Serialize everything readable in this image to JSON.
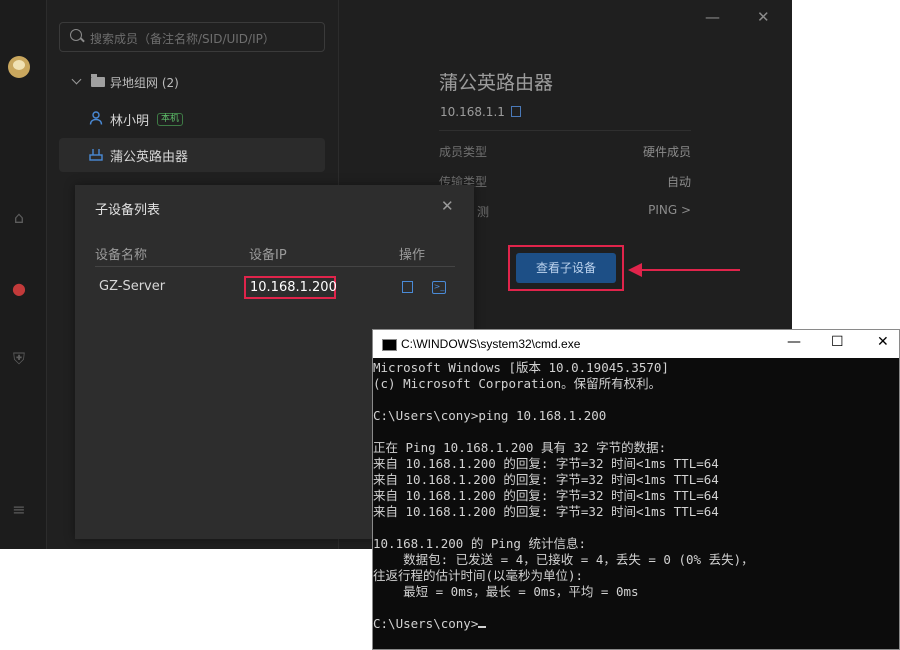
{
  "sidebar": {
    "search_placeholder": "搜索成员（备注名称/SID/UID/IP）",
    "group": {
      "label": "异地组网 (2)"
    },
    "members": [
      {
        "name": "林小明",
        "tag": "本机"
      },
      {
        "name": "蒲公英路由器"
      }
    ]
  },
  "detail": {
    "title": "蒲公英路由器",
    "ip": "10.168.1.1",
    "rows": [
      {
        "key": "成员类型",
        "value": "硬件成员"
      },
      {
        "key": "传输类型",
        "value": "自动"
      },
      {
        "key": "测",
        "value": "PING >"
      }
    ],
    "view_button": "查看子设备"
  },
  "window_controls": {
    "minimize": "—",
    "close": "✕"
  },
  "modal": {
    "title": "子设备列表",
    "close": "✕",
    "columns": [
      "设备名称",
      "设备IP",
      "操作"
    ],
    "row": {
      "name": "GZ-Server",
      "ip": "10.168.1.200"
    }
  },
  "cmd": {
    "title": "C:\\WINDOWS\\system32\\cmd.exe",
    "min": "—",
    "max": "☐",
    "close": "✕",
    "lines": [
      "Microsoft Windows [版本 10.0.19045.3570]",
      "(c) Microsoft Corporation。保留所有权利。",
      "",
      "C:\\Users\\cony>ping 10.168.1.200",
      "",
      "正在 Ping 10.168.1.200 具有 32 字节的数据:",
      "来自 10.168.1.200 的回复: 字节=32 时间<1ms TTL=64",
      "来自 10.168.1.200 的回复: 字节=32 时间<1ms TTL=64",
      "来自 10.168.1.200 的回复: 字节=32 时间<1ms TTL=64",
      "来自 10.168.1.200 的回复: 字节=32 时间<1ms TTL=64",
      "",
      "10.168.1.200 的 Ping 统计信息:",
      "    数据包: 已发送 = 4，已接收 = 4，丢失 = 0 (0% 丢失)，",
      "往返行程的估计时间(以毫秒为单位):",
      "    最短 = 0ms，最长 = 0ms，平均 = 0ms",
      "",
      "C:\\Users\\cony>"
    ]
  },
  "colors": {
    "accent_blue": "#1d4f86",
    "highlight_red": "#e0244b"
  }
}
